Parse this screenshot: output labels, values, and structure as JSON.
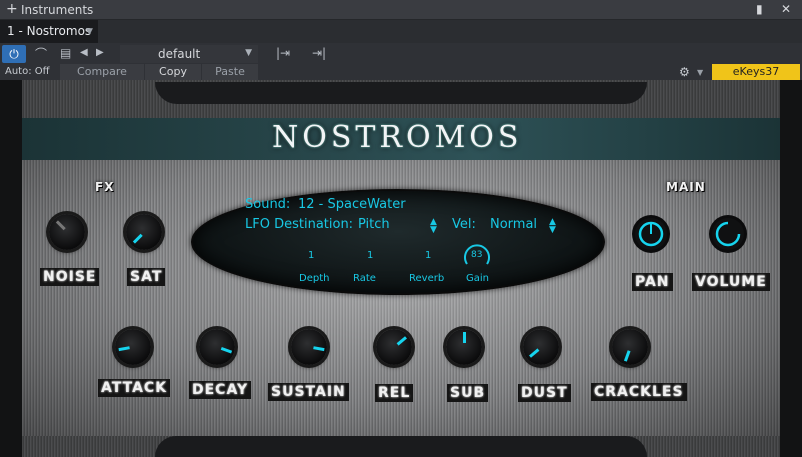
{
  "window": {
    "title": "Instruments",
    "tab": "1 - Nostromos"
  },
  "toolbar": {
    "auto_label": "Auto: Off",
    "preset": "default",
    "compare": "Compare",
    "copy": "Copy",
    "paste": "Paste",
    "keyboard": "eKeys37",
    "accent": "#2f6fb6",
    "keyboard_color": "#f0c419"
  },
  "plugin": {
    "logo": "NOSTROMOS",
    "fx_label": "FX",
    "main_label": "MAIN",
    "noise": "NOISE",
    "sat": "SAT",
    "pan": "PAN",
    "volume": "VOLUME",
    "sound_label": "Sound:",
    "sound_value": "12 - SpaceWater",
    "lfo_label": "LFO Destination:",
    "lfo_value": "Pitch",
    "vel_label": "Vel:",
    "vel_value": "Normal",
    "minis": [
      {
        "label": "Depth",
        "value": "1"
      },
      {
        "label": "Rate",
        "value": "1"
      },
      {
        "label": "Reverb",
        "value": "1"
      },
      {
        "label": "Gain",
        "value": "83"
      }
    ],
    "envelope": [
      {
        "label": "ATTACK"
      },
      {
        "label": "DECAY"
      },
      {
        "label": "SUSTAIN"
      },
      {
        "label": "REL"
      },
      {
        "label": "SUB"
      },
      {
        "label": "DUST"
      },
      {
        "label": "CRACKLES"
      }
    ],
    "accent": "#16d4ee"
  }
}
